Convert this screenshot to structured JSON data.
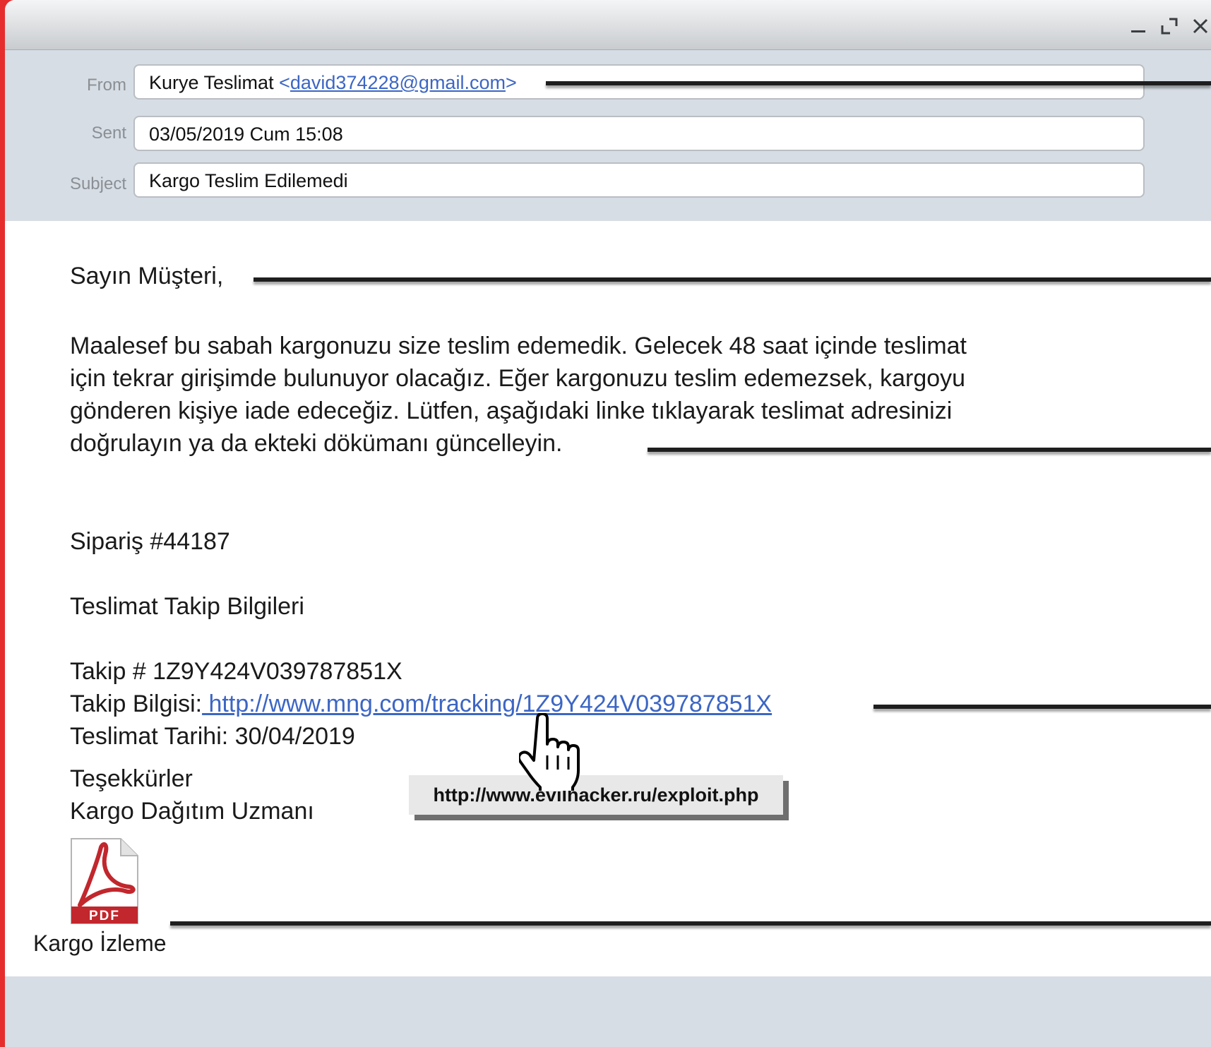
{
  "window": {
    "controls": [
      {
        "name": "minimize-icon"
      },
      {
        "name": "maximize-icon"
      },
      {
        "name": "close-icon"
      }
    ]
  },
  "header": {
    "from_label": "From",
    "from_name": "Kurye Teslimat",
    "from_email_open": "<",
    "from_email": "david374228@gmail.com",
    "from_email_close": ">",
    "sent_label": "Sent",
    "sent_value": "03/05/2019 Cum 15:08",
    "subject_label": "Subject",
    "subject_value": "Kargo Teslim Edilemedi"
  },
  "body": {
    "greeting": "Sayın Müşteri,",
    "paragraph_lines": [
      "Maalesef bu sabah kargonuzu size teslim edemedik. Gelecek 48 saat içinde teslimat",
      "için tekrar girişimde bulunuyor olacağız. Eğer kargonuzu teslim edemezsek, kargoyu",
      "gönderen kişiye iade edeceğiz. Lütfen, aşağıdaki linke tıklayarak teslimat adresinizi",
      "doğrulayın ya da ekteki dökümanı güncelleyin."
    ],
    "order": "Sipariş #44187",
    "tracking_heading": "Teslimat Takip Bilgileri",
    "tracking_number": "Takip # 1Z9Y424V039787851X",
    "tracking_info_label": "Takip Bilgisi:",
    "tracking_link": " http://www.mng.com/tracking/1Z9Y424V039787851X",
    "delivery_date": "Teslimat Tarihi: 30/04/2019",
    "thanks": "Teşekkürler",
    "signature": "Kargo Dağıtım Uzmanı"
  },
  "tooltip": {
    "url": "http://www.evilhacker.ru/exploit.php"
  },
  "attachment": {
    "icon": "pdf-icon",
    "badge": "PDF",
    "name": "Kargo İzleme"
  },
  "colors": {
    "frame": "#e52d2d",
    "header_bg": "#d7dde4",
    "link": "#3c66c4",
    "callout": "#1e1e1e",
    "pdf_red": "#c1272d"
  }
}
